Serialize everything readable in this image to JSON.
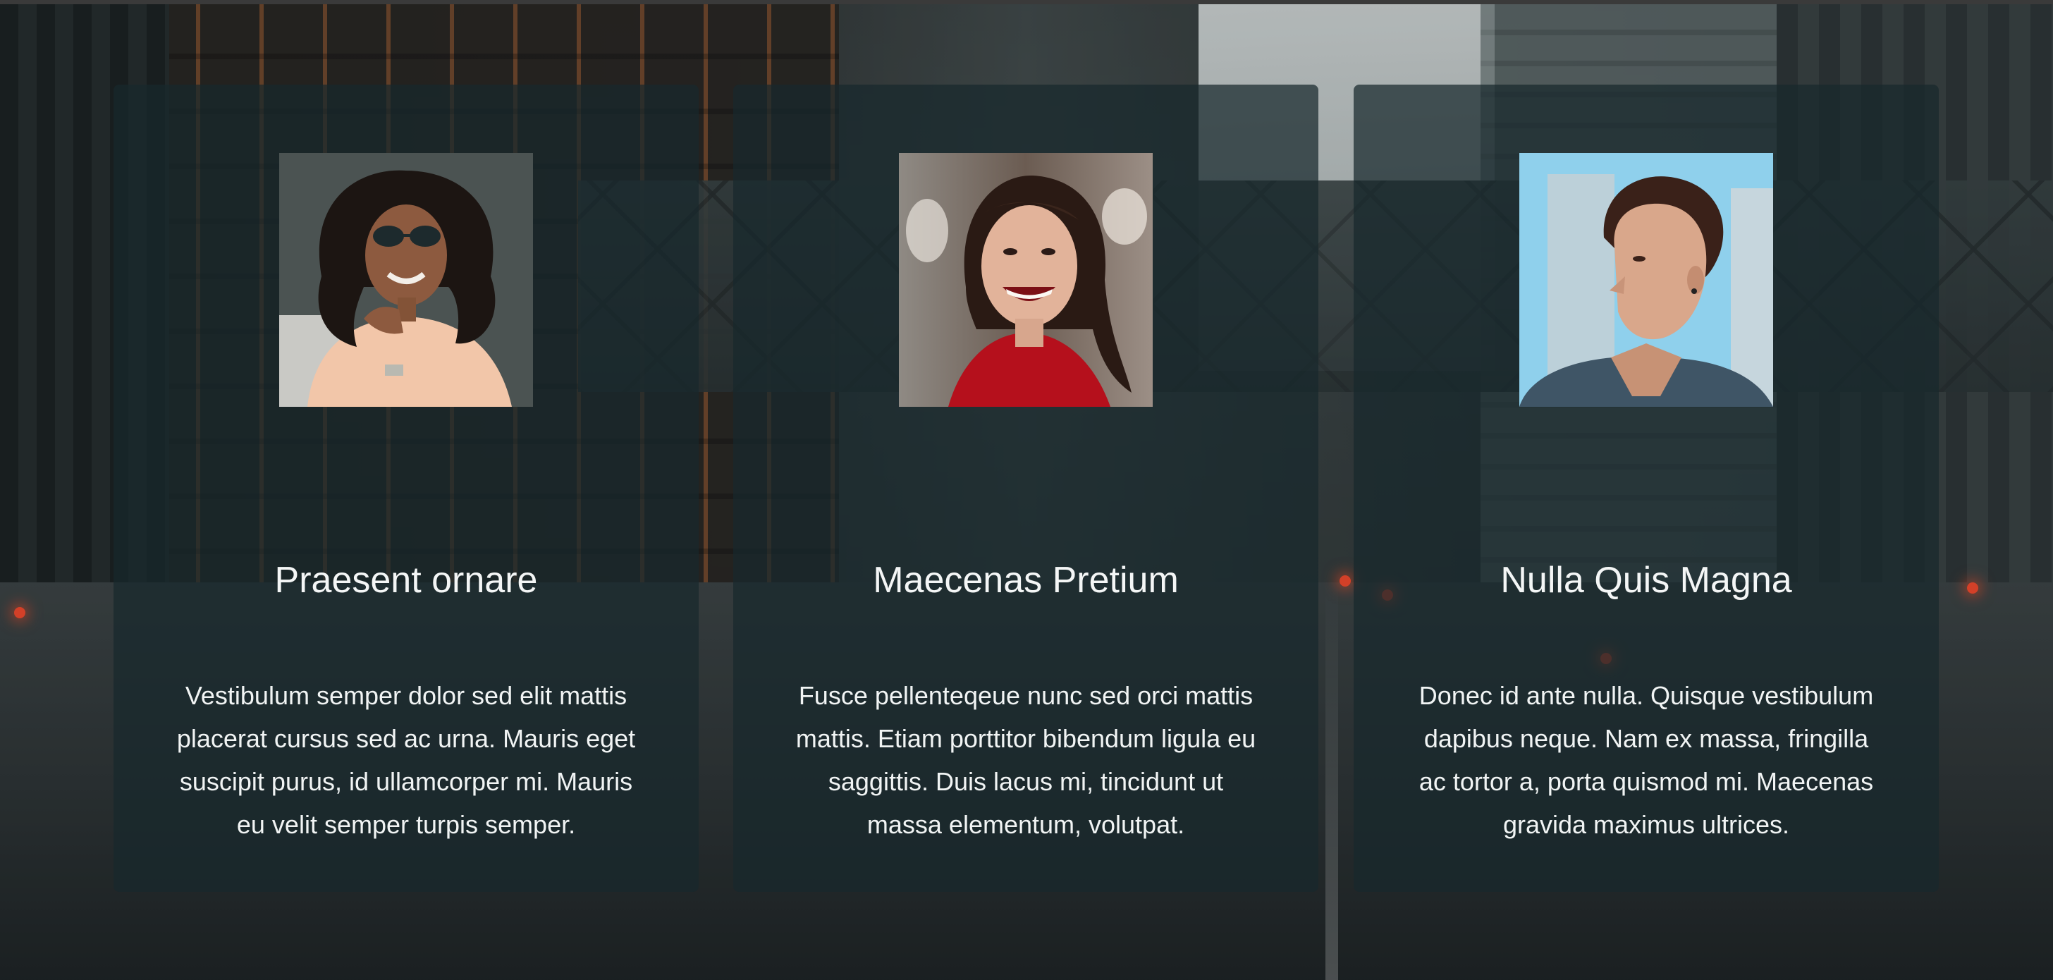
{
  "cards": [
    {
      "name": "Praesent ornare",
      "text": "Vestibulum semper dolor sed elit mattis placerat cursus sed ac urna. Mauris eget suscipit purus, id ullamcorper mi. Mauris eu velit semper turpis semper."
    },
    {
      "name": "Maecenas Pretium",
      "text": "Fusce pellenteqeue nunc sed orci mattis mattis. Etiam porttitor bibendum ligula eu saggittis. Duis lacus mi, tincidunt ut massa elementum, volutpat."
    },
    {
      "name": "Nulla Quis Magna",
      "text": "Donec id ante nulla. Quisque vestibulum dapibus neque. Nam ex massa, fringilla ac tortor a, porta quismod mi. Maecenas gravida maximus ultrices."
    }
  ],
  "colors": {
    "card_background": "#18282c",
    "text": "#f4f6f6"
  }
}
